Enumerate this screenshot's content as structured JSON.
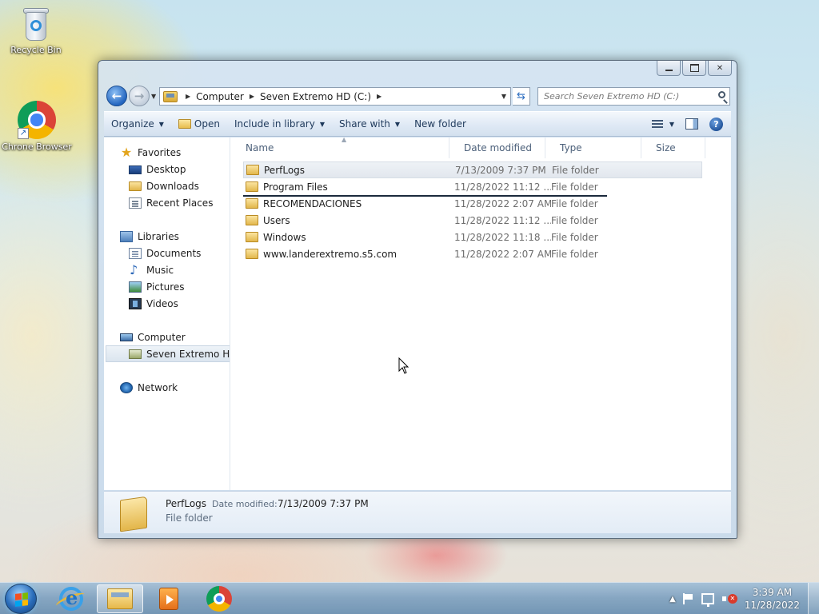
{
  "desktop": {
    "icons": [
      {
        "label": "Recycle Bin",
        "icon": "recycle-bin-icon"
      },
      {
        "label": "Chrone Browser",
        "icon": "chrome-icon"
      }
    ]
  },
  "explorer": {
    "address": {
      "crumbs": [
        "Computer",
        "Seven Extremo HD (C:)"
      ]
    },
    "search": {
      "placeholder": "Search Seven Extremo HD (C:)"
    },
    "commands": {
      "organize": "Organize",
      "open": "Open",
      "include_in_library": "Include in library",
      "share_with": "Share with",
      "new_folder": "New folder"
    },
    "nav": {
      "favorites": "Favorites",
      "desktop": "Desktop",
      "downloads": "Downloads",
      "recent_places": "Recent Places",
      "libraries": "Libraries",
      "documents": "Documents",
      "music": "Music",
      "pictures": "Pictures",
      "videos": "Videos",
      "computer": "Computer",
      "drive": "Seven Extremo HD (C:)",
      "network": "Network"
    },
    "columns": {
      "name": "Name",
      "date_modified": "Date modified",
      "type": "Type",
      "size": "Size"
    },
    "files": [
      {
        "name": "PerfLogs",
        "date": "7/13/2009 7:37 PM",
        "type": "File folder"
      },
      {
        "name": "Program Files",
        "date": "11/28/2022 11:12 ...",
        "type": "File folder"
      },
      {
        "name": "RECOMENDACIONES",
        "date": "11/28/2022 2:07 AM",
        "type": "File folder"
      },
      {
        "name": "Users",
        "date": "11/28/2022 11:12 ...",
        "type": "File folder"
      },
      {
        "name": "Windows",
        "date": "11/28/2022 11:18 ...",
        "type": "File folder"
      },
      {
        "name": "www.landerextremo.s5.com",
        "date": "11/28/2022 2:07 AM",
        "type": "File folder"
      }
    ],
    "details": {
      "name": "PerfLogs",
      "date_label": "Date modified:",
      "date_value": "7/13/2009 7:37 PM",
      "type": "File folder"
    }
  },
  "taskbar": {
    "clock_time": "3:39 AM",
    "clock_date": "11/28/2022",
    "tray_expand": "▲"
  },
  "colors": {
    "accent": "#2466c0",
    "folder": "#e2b74c"
  }
}
